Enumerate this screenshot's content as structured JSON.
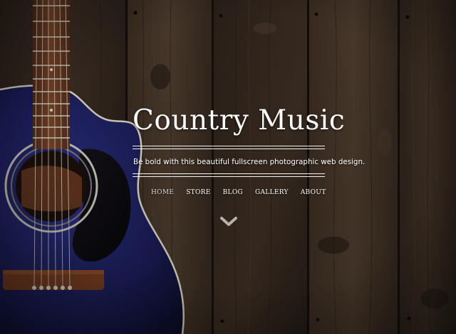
{
  "hero": {
    "title": "Country Music",
    "tagline": "Be bold with this beautiful fullscreen photographic web design."
  },
  "nav": {
    "items": [
      {
        "label": "HOME",
        "active": true
      },
      {
        "label": "STORE",
        "active": false
      },
      {
        "label": "BLOG",
        "active": false
      },
      {
        "label": "GALLERY",
        "active": false
      },
      {
        "label": "ABOUT",
        "active": false
      }
    ]
  },
  "scroll": {
    "icon": "chevron-down-icon"
  },
  "colors": {
    "text": "#ffffff",
    "wood": "#3a2b20",
    "guitar_body": "#1c1e5a",
    "fretboard": "#6a3a22"
  }
}
